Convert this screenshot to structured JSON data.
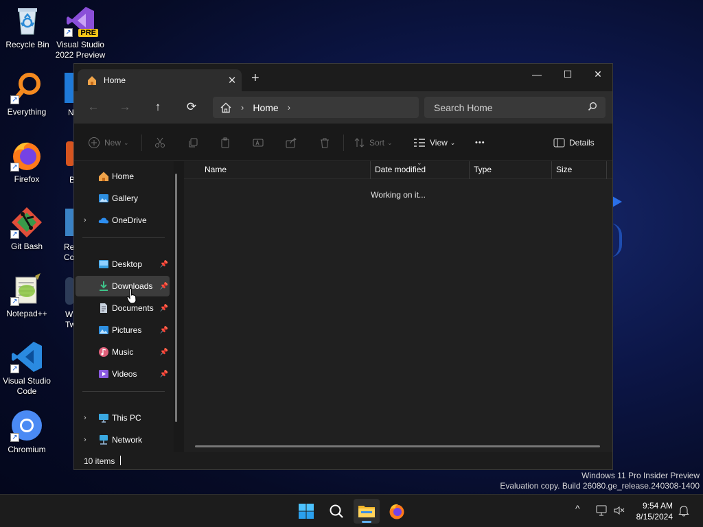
{
  "desktop": {
    "icons": [
      {
        "label": "Recycle Bin"
      },
      {
        "label": "Visual Studio 2022 Preview",
        "badge": "PRE"
      },
      {
        "label": "Everything"
      },
      {
        "label": "Firefox"
      },
      {
        "label": "Git Bash"
      },
      {
        "label": "Notepad++"
      },
      {
        "label": "Visual Studio Code"
      },
      {
        "label": "Chromium"
      }
    ],
    "partial_labels": [
      "N",
      "B",
      "Re",
      "Co",
      "W",
      "Tw"
    ],
    "watermark": {
      "line1": "Windows 11 Pro Insider Preview",
      "line2": "Evaluation copy. Build 26080.ge_release.240308-1400"
    }
  },
  "explorer": {
    "tab": {
      "title": "Home",
      "close": "✕"
    },
    "new_tab": "+",
    "window_controls": {
      "minimize": "—",
      "maximize": "☐",
      "close": "✕"
    },
    "nav": {
      "back": "←",
      "forward": "→",
      "up": "↑",
      "refresh": "⟳"
    },
    "breadcrumb": {
      "home_icon": "home-icon",
      "sep": "›",
      "current": "Home",
      "trail": "›"
    },
    "search": {
      "placeholder": "Search Home"
    },
    "toolbar": {
      "new": "New",
      "sort": "Sort",
      "view": "View",
      "more": "•••",
      "details": "Details"
    },
    "sidebar": {
      "group1": [
        {
          "label": "Home",
          "icon": "home-icon"
        },
        {
          "label": "Gallery",
          "icon": "gallery-icon"
        },
        {
          "label": "OneDrive",
          "icon": "onedrive-icon",
          "expand": "›"
        }
      ],
      "group2": [
        {
          "label": "Desktop",
          "icon": "desktop-icon",
          "pin": "📌"
        },
        {
          "label": "Downloads",
          "icon": "downloads-icon",
          "pin": "📌"
        },
        {
          "label": "Documents",
          "icon": "documents-icon",
          "pin": "📌"
        },
        {
          "label": "Pictures",
          "icon": "pictures-icon",
          "pin": "📌"
        },
        {
          "label": "Music",
          "icon": "music-icon",
          "pin": "📌"
        },
        {
          "label": "Videos",
          "icon": "videos-icon",
          "pin": "📌"
        }
      ],
      "group3": [
        {
          "label": "This PC",
          "icon": "pc-icon",
          "expand": "›"
        },
        {
          "label": "Network",
          "icon": "network-icon",
          "expand": "›"
        }
      ],
      "selected": "Downloads"
    },
    "columns": [
      "Name",
      "Date modified",
      "Type",
      "Size"
    ],
    "status_message": "Working on it...",
    "statusbar": {
      "items": "10 items"
    }
  },
  "taskbar": {
    "clock": {
      "time": "9:54 AM",
      "date": "8/15/2024"
    },
    "tray_chevron": "^",
    "accent": "#60b0f0"
  }
}
